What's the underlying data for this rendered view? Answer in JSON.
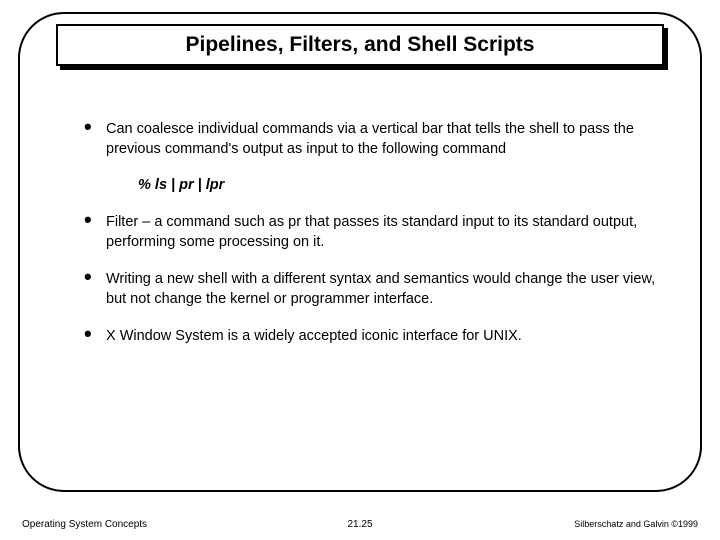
{
  "title": "Pipelines, Filters, and Shell Scripts",
  "bullets": [
    "Can coalesce individual commands via a vertical bar that tells the shell to pass the previous command's output as input to the following command",
    "Filter – a command such as pr that passes its standard input to its standard output, performing some processing on it.",
    "Writing a new shell with a different syntax and semantics would change the user view, but not change the kernel or programmer interface.",
    "X Window System is a widely accepted iconic interface for UNIX."
  ],
  "example": "% ls | pr | lpr",
  "footer": {
    "left": "Operating System Concepts",
    "center": "21.25",
    "right": "Silberschatz and Galvin ©1999"
  }
}
